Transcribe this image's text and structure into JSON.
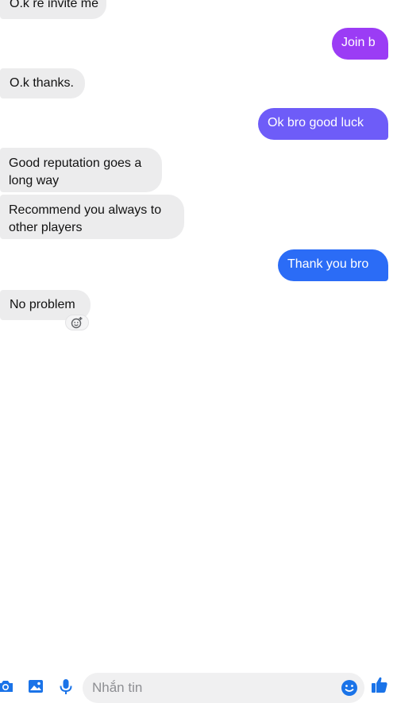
{
  "colors": {
    "outgoing_1": "#9b3cf5",
    "outgoing_2": "#6e5cf8",
    "outgoing_3": "#2b6cf6",
    "incoming": "#ececed",
    "accent": "#1a73e8"
  },
  "messages": [
    {
      "text": "O.k re invite me",
      "direction": "incoming"
    },
    {
      "text": "Join b",
      "direction": "outgoing"
    },
    {
      "text": "O.k thanks.",
      "direction": "incoming"
    },
    {
      "text": "Ok bro good luck",
      "direction": "outgoing"
    },
    {
      "text": "Good reputation goes a long way",
      "direction": "incoming"
    },
    {
      "text": "Recommend you always to other players",
      "direction": "incoming"
    },
    {
      "text": "Thank you bro",
      "direction": "outgoing"
    },
    {
      "text": "No problem",
      "direction": "incoming"
    }
  ],
  "composer": {
    "placeholder": "Nhắn tin",
    "icons": [
      "camera-icon",
      "gallery-icon",
      "microphone-icon",
      "emoji-icon",
      "thumbs-up-icon"
    ]
  },
  "reaction_icon": "add-reaction-icon"
}
